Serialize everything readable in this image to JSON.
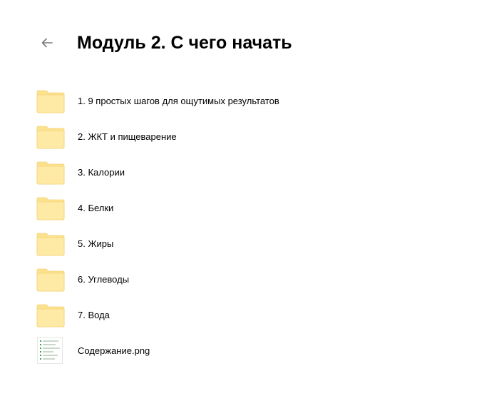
{
  "header": {
    "back_icon": "arrow-left-icon",
    "title": "Модуль 2. С чего начать"
  },
  "colors": {
    "folder_fill": "#FFEAA5",
    "folder_tab": "#FDE28E",
    "folder_stroke": "#F2D27A",
    "icon_gray": "#7a7a7a"
  },
  "items": [
    {
      "label": "1. 9 простых шагов для ощутимых результатов",
      "icon": "folder-icon"
    },
    {
      "label": "2. ЖКТ и пищеварение",
      "icon": "folder-icon"
    },
    {
      "label": "3. Калории",
      "icon": "folder-icon"
    },
    {
      "label": "4. Белки",
      "icon": "folder-icon"
    },
    {
      "label": "5. Жиры",
      "icon": "folder-icon"
    },
    {
      "label": "6. Углеводы",
      "icon": "folder-icon"
    },
    {
      "label": "7. Вода",
      "icon": "folder-icon"
    },
    {
      "label": "Содержание.png",
      "icon": "image-thumbnail-icon"
    }
  ]
}
